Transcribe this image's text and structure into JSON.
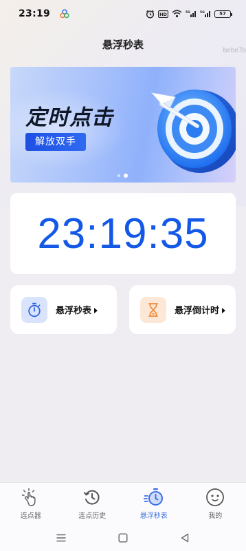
{
  "status_bar": {
    "time": "23:19",
    "battery": "57"
  },
  "header": {
    "title": "悬浮秒表",
    "watermark": "bebe7b"
  },
  "banner": {
    "title": "定时点击",
    "tag": "解放双手",
    "slide_count": 2,
    "active_slide": 2
  },
  "clock": {
    "time": "23:19:35",
    "color": "#1358e6"
  },
  "features": [
    {
      "label": "悬浮秒表",
      "icon": "stopwatch-icon",
      "color": "#2f66e0"
    },
    {
      "label": "悬浮倒计时",
      "icon": "hourglass-icon",
      "color": "#f08a3a"
    }
  ],
  "bottom_nav": {
    "items": [
      {
        "label": "连点器",
        "icon": "tap-hand-icon"
      },
      {
        "label": "连点历史",
        "icon": "history-clock-icon"
      },
      {
        "label": "悬浮秒表",
        "icon": "stopwatch-icon",
        "active": true
      },
      {
        "label": "我的",
        "icon": "face-icon"
      }
    ],
    "active_color": "#3b6fe3"
  },
  "system_nav": {
    "buttons": [
      "menu-icon",
      "home-icon",
      "back-icon"
    ]
  }
}
